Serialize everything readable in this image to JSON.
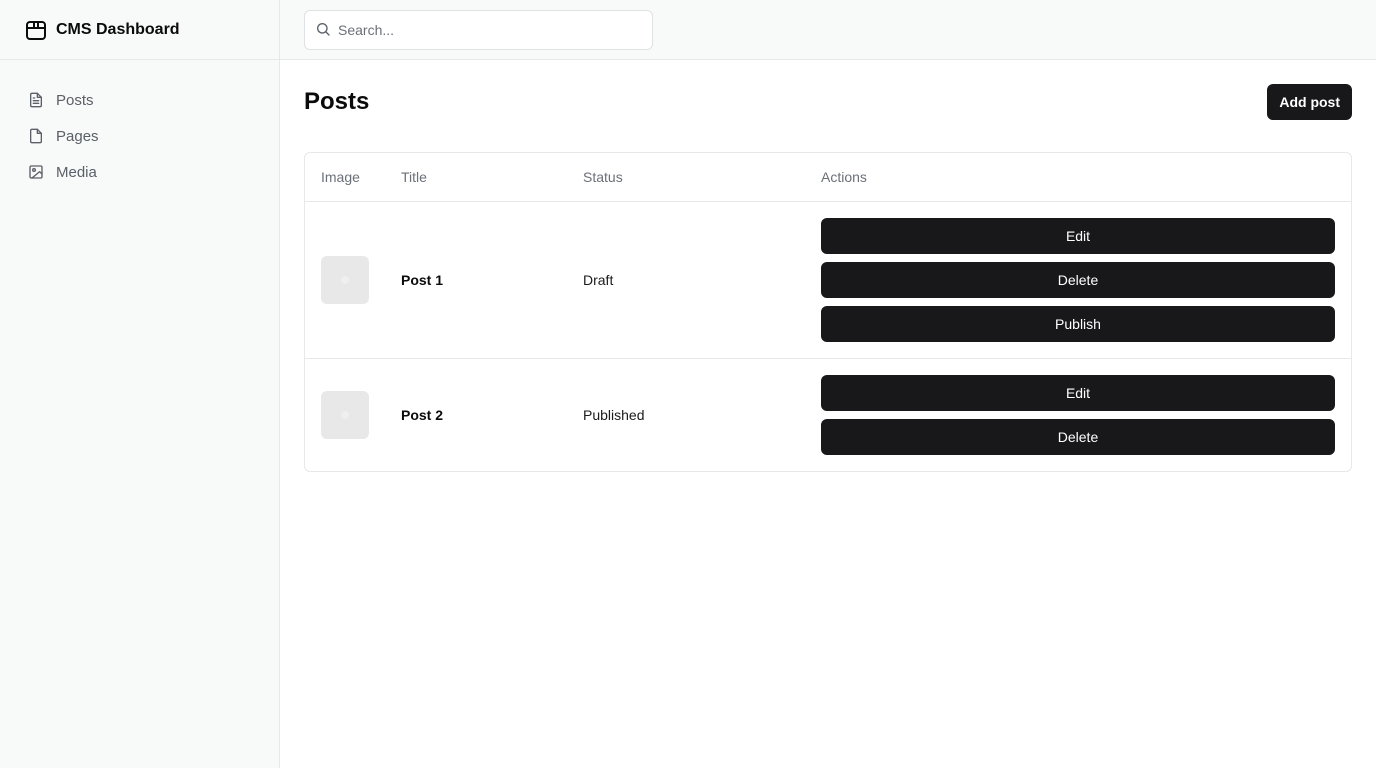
{
  "app": {
    "title": "CMS Dashboard",
    "icon": "package-box-icon"
  },
  "sidebar": {
    "items": [
      {
        "label": "Posts",
        "icon": "file-text-icon"
      },
      {
        "label": "Pages",
        "icon": "file-icon"
      },
      {
        "label": "Media",
        "icon": "image-icon"
      }
    ]
  },
  "search": {
    "placeholder": "Search...",
    "value": ""
  },
  "main": {
    "title": "Posts",
    "add_button": "Add post"
  },
  "table": {
    "columns": [
      "Image",
      "Title",
      "Status",
      "Actions"
    ],
    "rows": [
      {
        "title": "Post 1",
        "status": "Draft",
        "actions": [
          "Edit",
          "Delete",
          "Publish"
        ]
      },
      {
        "title": "Post 2",
        "status": "Published",
        "actions": [
          "Edit",
          "Delete"
        ]
      }
    ]
  },
  "colors": {
    "primary_button": "#18181b",
    "sidebar_bg": "#f8f9f9",
    "border": "#e6e8ea",
    "muted_text": "#6b7078"
  }
}
